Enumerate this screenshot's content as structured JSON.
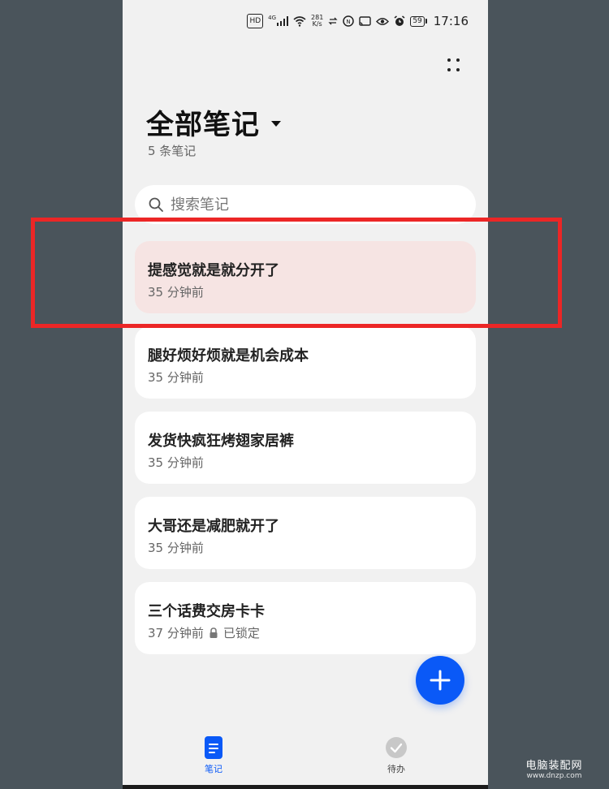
{
  "status_bar": {
    "hd_badge": "HD",
    "network": "4G",
    "speed_value": "281",
    "speed_unit": "K/s",
    "battery": "59",
    "time": "17:16"
  },
  "header": {
    "title": "全部笔记",
    "note_count": "5 条笔记"
  },
  "search": {
    "placeholder": "搜索笔记"
  },
  "notes": [
    {
      "title": "提感觉就是就分开了",
      "time": "35 分钟前"
    },
    {
      "title": "腿好烦好烦就是机会成本",
      "time": "35 分钟前"
    },
    {
      "title": "发货快疯狂烤翅家居裤",
      "time": "35 分钟前"
    },
    {
      "title": "大哥还是减肥就开了",
      "time": "35 分钟前"
    },
    {
      "title": "三个话费交房卡卡",
      "time": "37 分钟前",
      "lock_label": "已锁定"
    }
  ],
  "bottom_nav": {
    "notes_label": "笔记",
    "todo_label": "待办"
  },
  "watermark": {
    "main": "电脑装配网",
    "sub": "www.dnzp.com"
  },
  "colors": {
    "accent": "#0a59f7",
    "highlight_card": "#f6e4e3",
    "annotation_red": "#ec2626",
    "background": "#f1f1f1"
  }
}
